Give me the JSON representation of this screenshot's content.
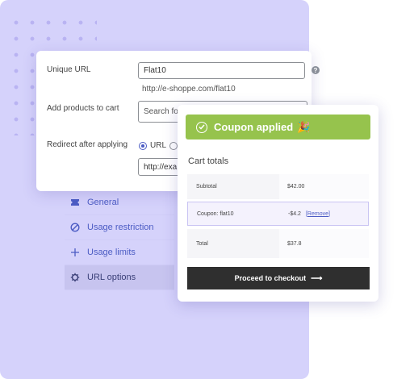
{
  "settings": {
    "unique_url_label": "Unique URL",
    "unique_url_value": "Flat10",
    "unique_url_hint": "http://e-shoppe.com/flat10",
    "add_products_label": "Add products to cart",
    "add_products_placeholder": "Search fo",
    "redirect_label": "Redirect after applying",
    "redirect_option_url": "URL",
    "redirect_url_value": "http://exa"
  },
  "tabs": [
    {
      "label": "General",
      "icon": "ticket-icon"
    },
    {
      "label": "Usage restriction",
      "icon": "ban-icon"
    },
    {
      "label": "Usage limits",
      "icon": "plus-icon"
    },
    {
      "label": "URL options",
      "icon": "gear-icon",
      "active": true
    }
  ],
  "cart": {
    "banner": "Coupon applied",
    "banner_emoji": "🎉",
    "title": "Cart totals",
    "rows": [
      {
        "label": "Subtotal",
        "value": "$42.00"
      },
      {
        "label": "Coupon: flat10",
        "value": "-$4.2",
        "action": "[Remove]"
      },
      {
        "label": "Total",
        "value": "$37.8"
      }
    ],
    "checkout_label": "Proceed to checkout",
    "checkout_arrow": "⟶"
  },
  "colors": {
    "panel": "#d5d2fb",
    "accent": "#4c5cc4",
    "success": "#96c34d",
    "checkout_bg": "#2f2f2f"
  }
}
